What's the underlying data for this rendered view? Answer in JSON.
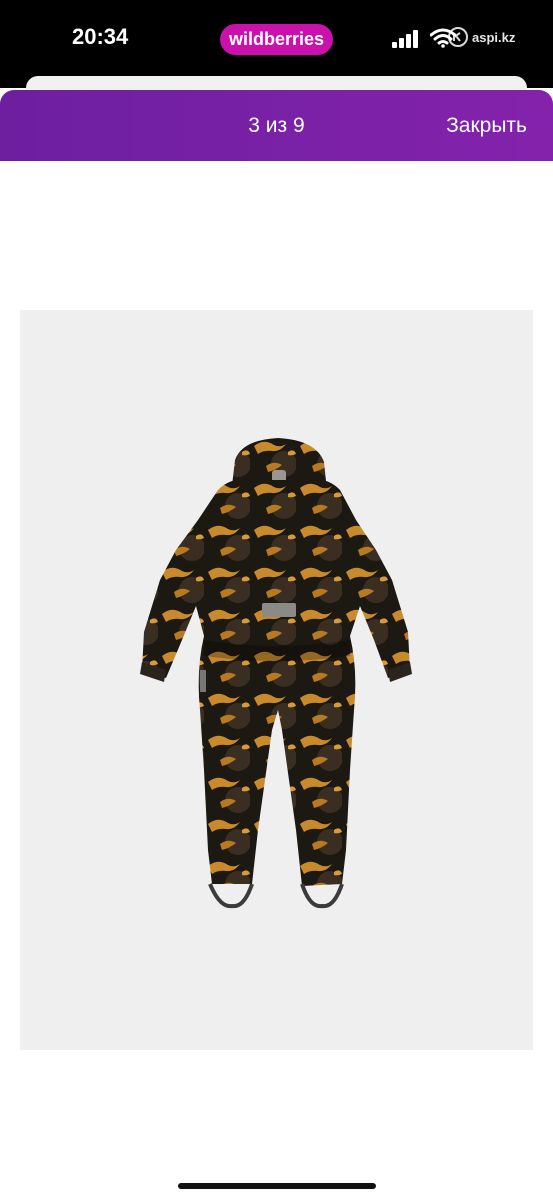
{
  "status_bar": {
    "time": "20:34",
    "app_badge": "wildberries",
    "overlay_watermark": "aspi.kz",
    "icons": [
      "signal-icon",
      "wifi-icon"
    ]
  },
  "viewer": {
    "page_counter": "3 из 9",
    "close_label": "Закрыть"
  },
  "photo": {
    "subject": "product-photo-kids-snowsuit-back-view"
  },
  "colors": {
    "header_gradient_start": "#6d1fa0",
    "header_gradient_end": "#8422ab",
    "app_badge": "#cb11ab",
    "photo_background": "#efefef"
  }
}
